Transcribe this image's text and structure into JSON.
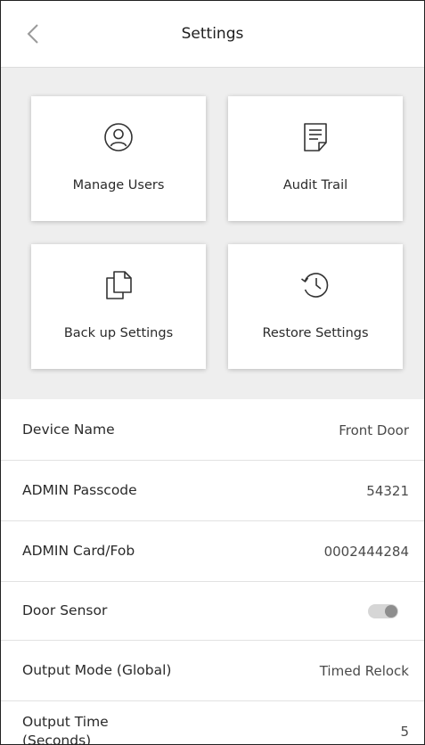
{
  "header": {
    "title": "Settings",
    "back_icon": "chevron-left-icon"
  },
  "tiles": [
    {
      "label": "Manage Users",
      "icon": "user-circle-icon"
    },
    {
      "label": "Audit Trail",
      "icon": "document-list-icon"
    },
    {
      "label": "Back up Settings",
      "icon": "copy-documents-icon"
    },
    {
      "label": "Restore Settings",
      "icon": "history-clock-icon"
    }
  ],
  "settings": {
    "device_name": {
      "label": "Device Name",
      "value": "Front Door"
    },
    "admin_passcode": {
      "label": "ADMIN Passcode",
      "value": "54321"
    },
    "admin_card": {
      "label": "ADMIN Card/Fob",
      "value": "0002444284"
    },
    "door_sensor": {
      "label": "Door Sensor",
      "enabled": false
    },
    "output_mode": {
      "label": "Output Mode (Global)",
      "value": "Timed Relock"
    },
    "output_time": {
      "label": "Output Time (Seconds)",
      "value": "5"
    }
  },
  "colors": {
    "tile_area_bg": "#eeeeee",
    "text": "#2a2a2a",
    "divider": "#e2e2e2"
  }
}
